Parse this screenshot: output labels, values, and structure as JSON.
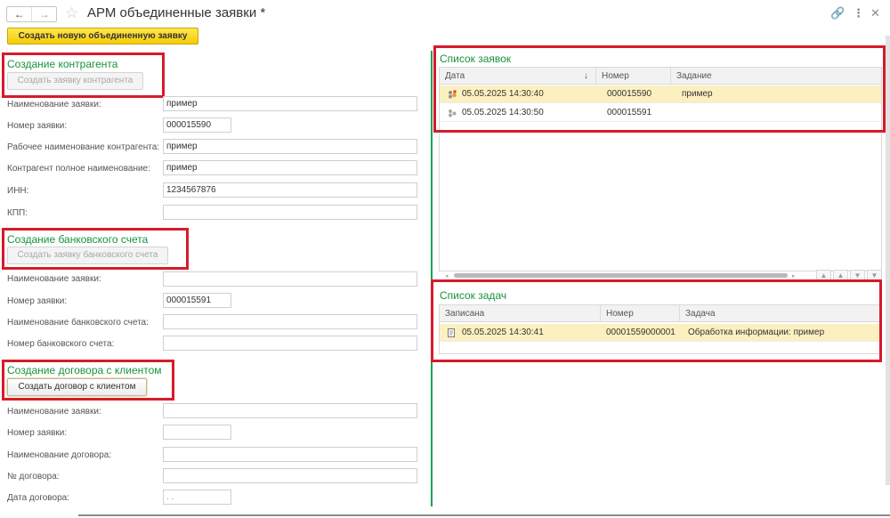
{
  "window": {
    "title": "АРМ объединенные заявки *"
  },
  "toolbar": {
    "create_button": "Создать новую объединенную заявку"
  },
  "counterparty": {
    "title": "Создание контрагента",
    "button": "Создать заявку контрагента",
    "fields": [
      {
        "label": "Наименование заявки:",
        "value": "пример"
      },
      {
        "label": "Номер заявки:",
        "value": "000015590"
      },
      {
        "label": "Рабочее наименование контрагента:",
        "value": "пример"
      },
      {
        "label": "Контрагент полное наименование:",
        "value": "пример"
      },
      {
        "label": "ИНН:",
        "value": "1234567876"
      },
      {
        "label": "КПП:",
        "value": ""
      }
    ]
  },
  "bank": {
    "title": "Создание банковского счета",
    "button": "Создать заявку банковского счета",
    "fields": [
      {
        "label": "Наименование заявки:",
        "value": ""
      },
      {
        "label": "Номер заявки:",
        "value": "000015591"
      },
      {
        "label": "Наименование банковского счета:",
        "value": ""
      },
      {
        "label": "Номер банковского счета:",
        "value": ""
      }
    ]
  },
  "contract": {
    "title": "Создание договора с клиентом",
    "button": "Создать договор с клиентом",
    "fields": [
      {
        "label": "Наименование заявки:",
        "value": ""
      },
      {
        "label": "Номер заявки:",
        "value": ""
      },
      {
        "label": "Наименование договора:",
        "value": ""
      },
      {
        "label": "№ договора:",
        "value": ""
      },
      {
        "label": "Дата договора:",
        "value": "  .  ."
      }
    ]
  },
  "requests": {
    "title": "Список заявок",
    "columns": [
      "Дата",
      "Номер",
      "Задание"
    ],
    "sort_indicator": "↓",
    "rows": [
      {
        "date": "05.05.2025 14:30:40",
        "number": "000015590",
        "task": "пример",
        "selected": true
      },
      {
        "date": "05.05.2025 14:30:50",
        "number": "000015591",
        "task": "",
        "selected": false
      }
    ]
  },
  "tasks": {
    "title": "Список задач",
    "columns": [
      "Записана",
      "Номер",
      "Задача"
    ],
    "rows": [
      {
        "recorded": "05.05.2025 14:30:41",
        "number": "00001559000001",
        "task": "Обработка информации: пример",
        "selected": true
      }
    ]
  },
  "colors": {
    "accent_green": "#19923c",
    "highlight_red": "#d61b2a",
    "selected_row": "#fcf0c0",
    "button_yellow": "#f5cb05"
  },
  "icons": [
    "back-arrow-icon",
    "forward-arrow-icon",
    "star-icon",
    "link-icon",
    "more-icon",
    "close-icon",
    "request-icon",
    "task-icon"
  ]
}
